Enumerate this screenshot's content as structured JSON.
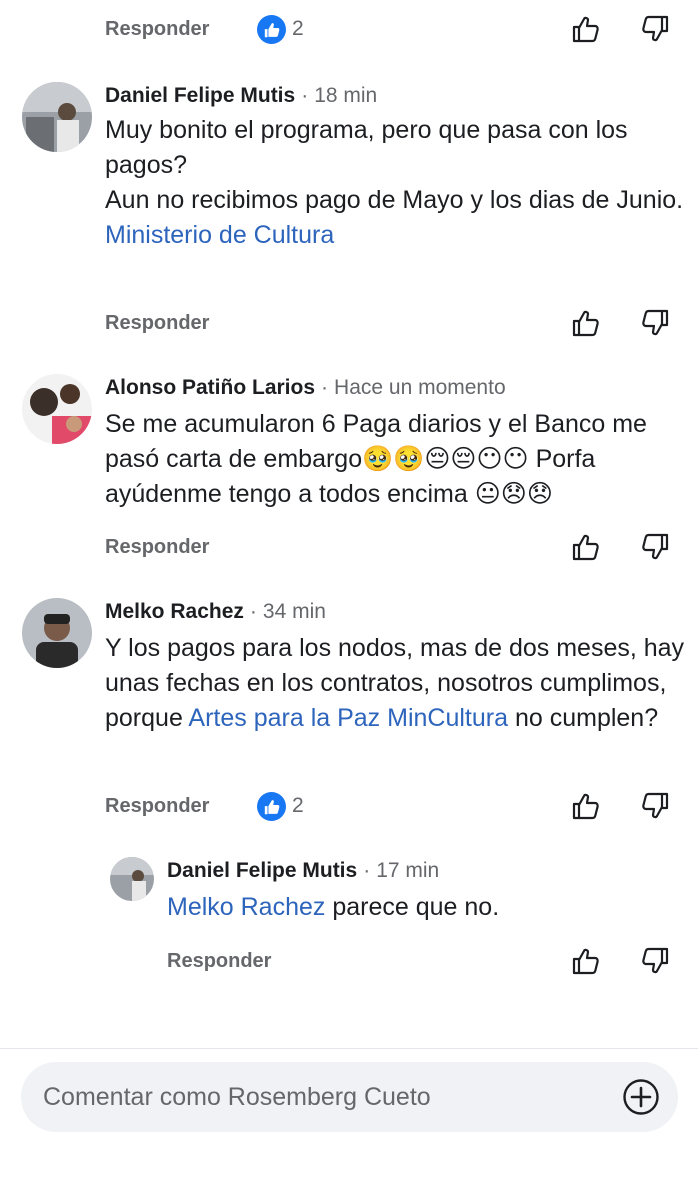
{
  "top_actions": {
    "reply": "Responder",
    "likes": "2"
  },
  "comments": [
    {
      "name": "Daniel Felipe Mutis",
      "time": "18 min",
      "text_1": "Muy bonito el programa, pero que pasa con los pagos?",
      "text_2": "Aun no recibimos pago de Mayo y los dias de Junio.",
      "mention": "Ministerio de Cultura",
      "reply": "Responder"
    },
    {
      "name": "Alonso Patiño Larios",
      "time": "Hace un momento",
      "text_1": "Se me acumularon 6 Paga diarios y el Banco me pasó carta de embargo",
      "emojis_1": "🥹🥹😔😔😶😶",
      "text_2": " Porfa ayúdenme tengo a todos encima ",
      "emojis_2": "😐😞😞",
      "reply": "Responder"
    },
    {
      "name": "Melko Rachez",
      "time": "34 min",
      "text_1": "Y los pagos para los nodos, mas de dos meses, hay unas fechas en los contratos, nosotros cumplimos,  porque ",
      "mention": "Artes para la Paz MinCultura",
      "text_2": " no cumplen?",
      "reply": "Responder",
      "likes": "2"
    },
    {
      "name": "Daniel Felipe Mutis",
      "time": "17 min",
      "mention": "Melko Rachez",
      "text_1": " parece que no.",
      "reply": "Responder"
    }
  ],
  "composer": {
    "placeholder": "Comentar como Rosemberg Cueto"
  },
  "colors": {
    "link": "#2d64bc",
    "like_blue": "#1877f2",
    "muted": "#65676b"
  }
}
